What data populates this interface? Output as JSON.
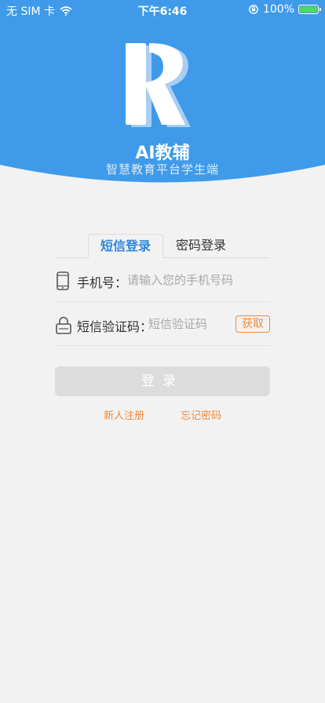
{
  "status_bar": {
    "carrier": "无 SIM 卡",
    "time": "下午6:46",
    "battery_percent": "100%"
  },
  "app": {
    "title": "AI教辅",
    "subtitle": "智慧教育平台学生端"
  },
  "tabs": [
    {
      "label": "短信登录",
      "active": true
    },
    {
      "label": "密码登录",
      "active": false
    }
  ],
  "form": {
    "phone_label": "手机号：",
    "phone_placeholder": "请输入您的手机号码",
    "code_label": "短信验证码：",
    "code_placeholder": "短信验证码",
    "get_code_label": "获取"
  },
  "login_label": "登录",
  "links": {
    "register": "新人注册",
    "forgot": "忘记密码"
  },
  "colors": {
    "header_blue": "#3f9be9",
    "accent_orange": "#f08a3a",
    "active_tab_blue": "#2e86de",
    "disabled_button": "#dcdcdc"
  }
}
